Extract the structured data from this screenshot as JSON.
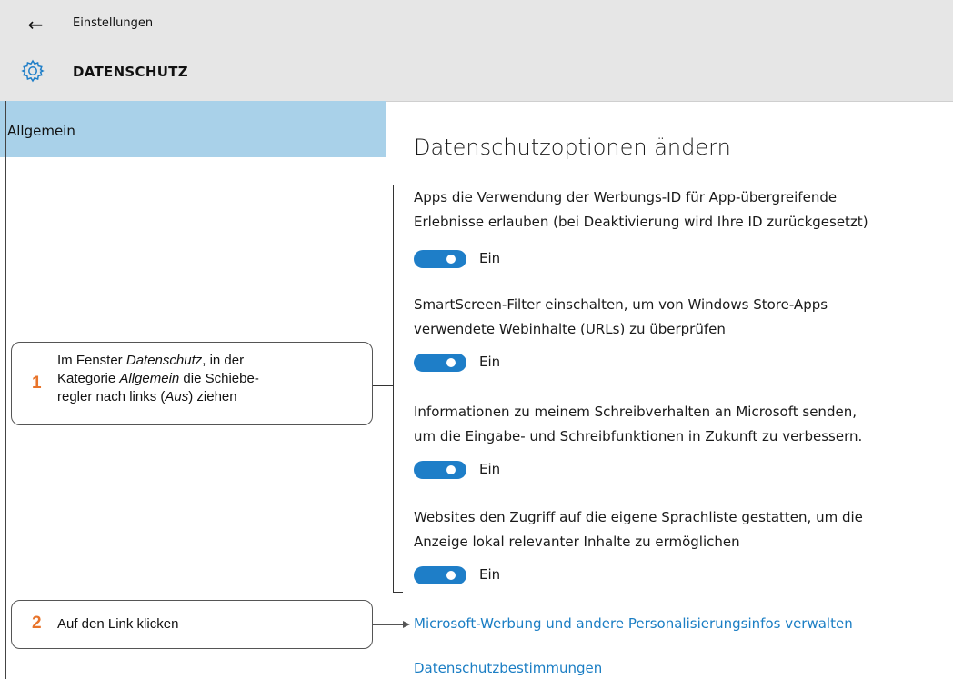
{
  "window": {
    "back_icon": "arrow-left-icon",
    "app_title": "Einstellungen",
    "gear_icon": "gear-icon",
    "page_heading": "DATENSCHUTZ"
  },
  "sidebar": {
    "items": [
      {
        "label": "Allgemein",
        "selected": true
      }
    ],
    "selected_color": "#a9d1e9"
  },
  "main": {
    "title": "Datenschutzoptionen ändern",
    "options": [
      {
        "line1": "Apps die Verwendung der Werbungs-ID für App-übergreifende",
        "line2": "Erlebnisse erlauben (bei Deaktivierung wird Ihre ID zurückgesetzt)",
        "toggle_state": "Ein",
        "on": true
      },
      {
        "line1": "SmartScreen-Filter einschalten, um von Windows Store-Apps",
        "line2": "verwendete Webinhalte (URLs) zu überprüfen",
        "toggle_state": "Ein",
        "on": true
      },
      {
        "line1": "Informationen zu meinem Schreibverhalten an Microsoft senden,",
        "line2": "um die Eingabe- und Schreibfunktionen in Zukunft zu verbessern.",
        "toggle_state": "Ein",
        "on": true
      },
      {
        "line1": "Websites den Zugriff auf die eigene Sprachliste gestatten, um die",
        "line2": "Anzeige lokal relevanter Inhalte zu ermöglichen",
        "toggle_state": "Ein",
        "on": true
      }
    ],
    "links": [
      "Microsoft-Werbung und andere Personalisierungsinfos verwalten",
      "Datenschutzbestimmungen"
    ],
    "toggle_color": "#1e7ec8",
    "link_color": "#1b7ec4"
  },
  "callouts": [
    {
      "number": "1",
      "line1_a": "Im Fenster ",
      "line1_b": "Datenschutz",
      "line1_c": ", in der",
      "line2_a": "Kategorie ",
      "line2_b": "Allgemein",
      "line2_c": " die Schiebe-",
      "line3_a": "regler nach links (",
      "line3_b": "Aus",
      "line3_c": ") ziehen"
    },
    {
      "number": "2",
      "text": "Auf den Link klicken"
    }
  ],
  "accent_number_color": "#e8742b"
}
